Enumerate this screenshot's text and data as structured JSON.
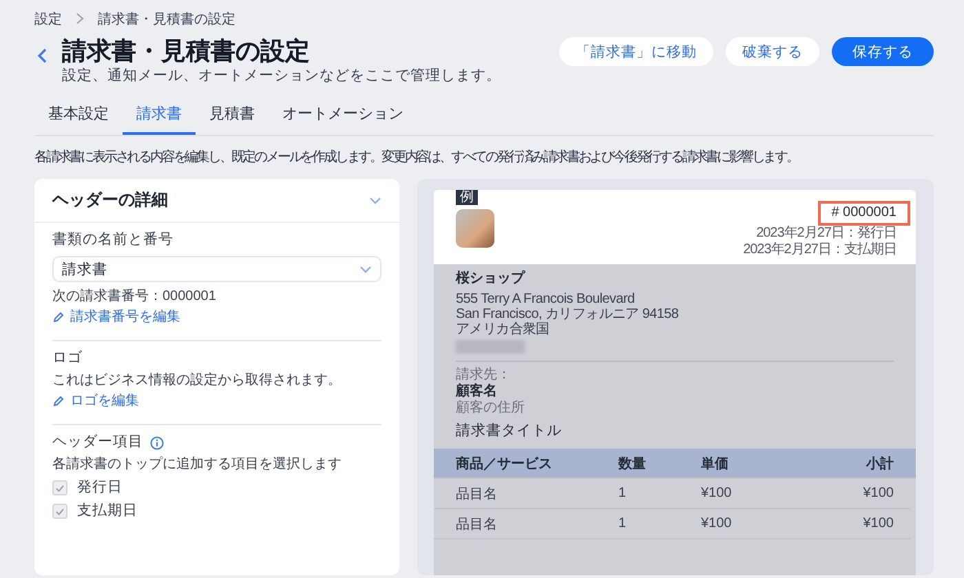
{
  "breadcrumb": [
    {
      "label": "設定"
    },
    {
      "label": "請求書・見積書の設定"
    }
  ],
  "header": {
    "title": "請求書・見積書の設定",
    "subtitle": "設定、通知メール、オートメーションなどをここで管理します。",
    "buttons": [
      {
        "label": "「請求書」に移動",
        "kind": "secondary"
      },
      {
        "label": "破棄する",
        "kind": "secondary"
      },
      {
        "label": "保存する",
        "kind": "primary"
      }
    ]
  },
  "tabs": [
    {
      "label": "基本設定",
      "selected": false
    },
    {
      "label": "請求書",
      "selected": true
    },
    {
      "label": "見積書",
      "selected": false
    },
    {
      "label": "オートメーション",
      "selected": false
    }
  ],
  "description": "各請求書に表示される内容を編集し、既定のメールを作成します。変更内容は、すべての発行済み請求書および今後発行する請求書に影響します。",
  "settings_panel": {
    "title": "ヘッダーの詳細",
    "document_name": {
      "label": "書類の名前と番号",
      "value": "請求書",
      "next_number": "次の請求書番号：0000001",
      "edit_link": "請求書番号を編集"
    },
    "logo": {
      "label": "ロゴ",
      "note": "これはビジネス情報の設定から取得されます。",
      "edit_link": "ロゴを編集"
    },
    "header_fields": {
      "label": "ヘッダー項目",
      "hint": "各請求書のトップに追加する項目を選択します",
      "items": [
        {
          "label": "発行日",
          "checked": true,
          "disabled": true
        },
        {
          "label": "支払期日",
          "checked": true,
          "disabled": true
        }
      ]
    }
  },
  "preview": {
    "badge": "例",
    "invoice_number": "# 0000001",
    "number_highlighted": true,
    "dates": [
      "2023年2月27日：発行日",
      "2023年2月27日：支払期日"
    ],
    "business": {
      "name": "桜ショップ",
      "address": [
        "555 Terry A Francois Boulevard",
        "San Francisco, カリフォルニア 94158",
        "アメリカ合衆国"
      ]
    },
    "bill_to": {
      "label": "請求先：",
      "name": "顧客名",
      "address": "顧客の住所"
    },
    "invoice_title": "請求書タイトル",
    "table": {
      "columns": [
        "商品／サービス",
        "数量",
        "単価",
        "小計"
      ],
      "rows": [
        [
          "品目名",
          "1",
          "¥100",
          "¥100"
        ],
        [
          "品目名",
          "1",
          "¥100",
          "¥100"
        ]
      ]
    }
  }
}
